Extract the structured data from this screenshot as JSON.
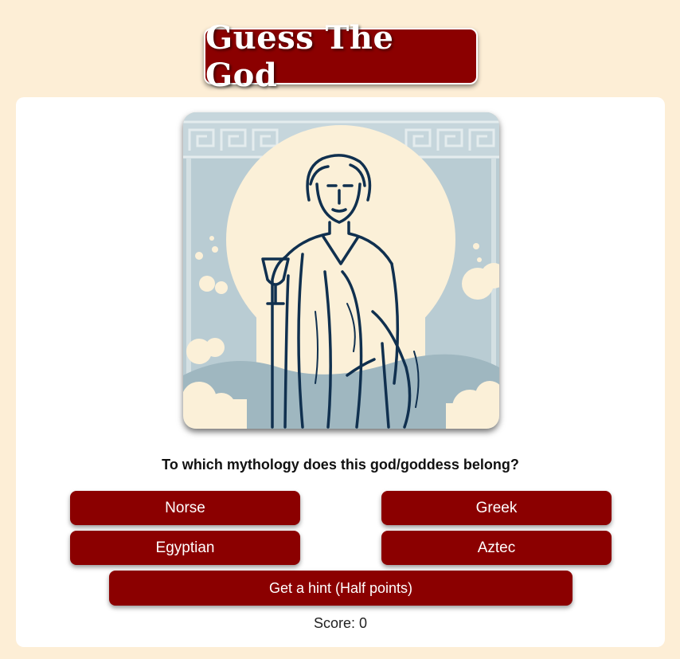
{
  "header": {
    "title": "Guess The God"
  },
  "illustration": {
    "subject": "Robed deity holding a chalice in front of a sun disc",
    "colors": {
      "sky": "#b9ccd3",
      "sun": "#fbf0d8",
      "line": "#10304f",
      "border": "#eae0cb"
    }
  },
  "quiz": {
    "question": "To which mythology does this god/goddess belong?",
    "options": [
      "Norse",
      "Greek",
      "Egyptian",
      "Aztec"
    ],
    "hint_label": "Get a hint (Half points)",
    "score_text": "Score: 0"
  },
  "theme": {
    "background": "#fdeed6",
    "accent": "#8b0000",
    "card": "#ffffff"
  }
}
